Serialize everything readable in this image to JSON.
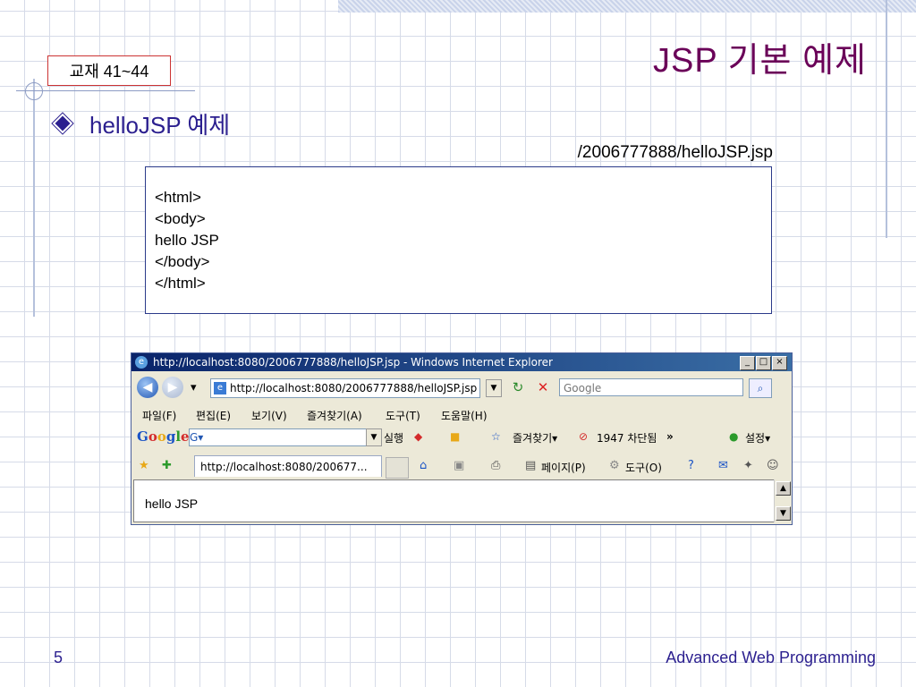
{
  "slide": {
    "title": "JSP 기본 예제",
    "reference": "교재 41~44",
    "bullet": "helloJSP 예제",
    "path": "/2006777888/helloJSP.jsp",
    "code_lines": [
      "<html>",
      "<body>",
      "hello JSP",
      "</body>",
      "</html>"
    ],
    "page_number": "5",
    "footer": "Advanced Web Programming"
  },
  "browser": {
    "window_title": "http://localhost:8080/2006777888/helloJSP.jsp - Windows Internet Explorer",
    "address": "http://localhost:8080/2006777888/helloJSP.jsp",
    "search_placeholder": "Google",
    "menu": [
      "파일(F)",
      "편집(E)",
      "보기(V)",
      "즐겨찾기(A)",
      "도구(T)",
      "도움말(H)"
    ],
    "google_toolbar": {
      "logo": "Google",
      "box_text": "G▾",
      "run": "실행",
      "favorites": "즐겨찾기▾",
      "blocked": "1947 차단됨",
      "more": "»",
      "settings": "설정▾"
    },
    "tab_label": "http://localhost:8080/200677...",
    "command_bar": {
      "page": "페이지(P)",
      "tools": "도구(O)"
    },
    "page_content": "hello JSP"
  },
  "colors": {
    "title": "#6a0058",
    "accent": "#2b1f8f",
    "ref_border": "#cc3333",
    "code_border": "#2b3a8a"
  }
}
